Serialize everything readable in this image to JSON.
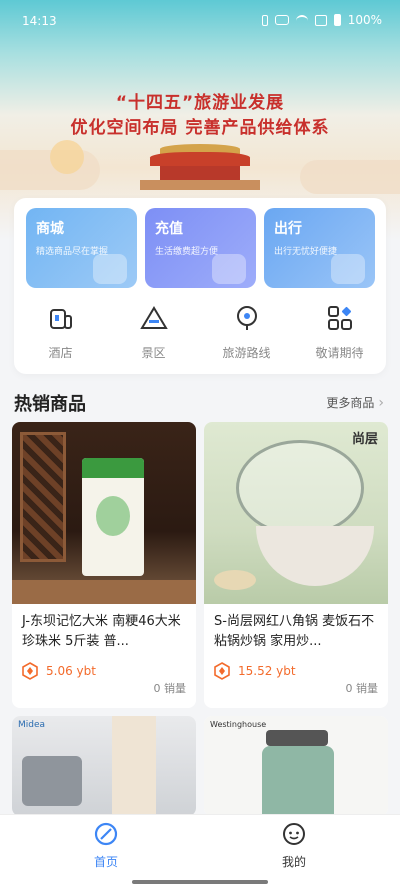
{
  "status_bar": {
    "time": "14:13",
    "battery": "100%"
  },
  "banner": {
    "line1": "“十四五”旅游业发展",
    "line2": "优化空间布局  完善产品供给体系"
  },
  "tiles": [
    {
      "title": "商城",
      "subtitle": "精选商品尽在掌握"
    },
    {
      "title": "充值",
      "subtitle": "生活缴费超方便"
    },
    {
      "title": "出行",
      "subtitle": "出行无忧好便捷"
    }
  ],
  "quick_icons": [
    {
      "label": "酒店",
      "icon": "hotel-icon"
    },
    {
      "label": "景区",
      "icon": "scenic-icon"
    },
    {
      "label": "旅游路线",
      "icon": "route-icon"
    },
    {
      "label": "敬请期待",
      "icon": "apps-icon"
    }
  ],
  "section": {
    "title": "热销商品",
    "more": "更多商品"
  },
  "products": [
    {
      "name": "J-东坝记忆大米 南粳46大米珍珠米 5斤装 普...",
      "price": "5.06 ybt",
      "sold": "0 销量"
    },
    {
      "name": "S-尚层网红八角锅 麦饭石不粘锅炒锅 家用炒...",
      "price": "15.52 ybt",
      "sold": "0 销量",
      "brand": "尚层"
    }
  ],
  "products_partial": [
    {
      "brand": "Midea"
    },
    {
      "brand": "Westinghouse"
    }
  ],
  "tabbar": {
    "home": "首页",
    "mine": "我的"
  },
  "colors": {
    "accent": "#3d86f5",
    "price": "#f36b2c",
    "banner_text": "#c8302c"
  }
}
